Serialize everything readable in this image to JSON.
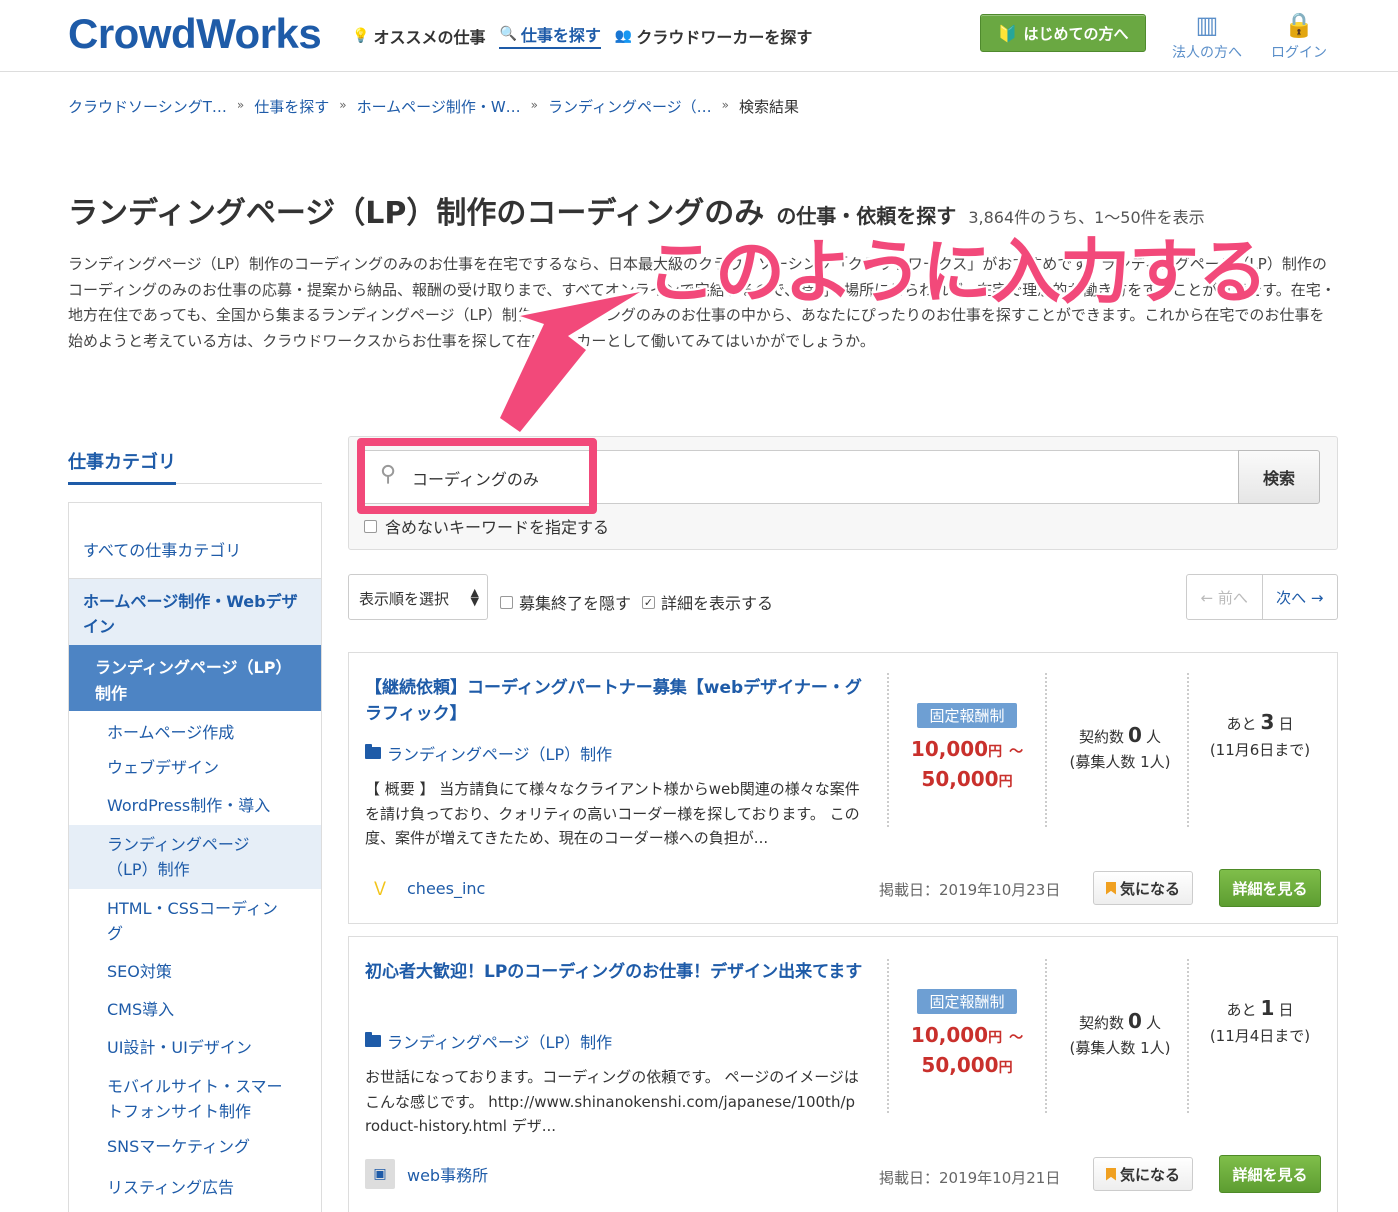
{
  "header": {
    "logo": "CrowdWorks",
    "nav": [
      {
        "label": "オススメの仕事",
        "icon": "lightbulb-icon"
      },
      {
        "label": "仕事を探す",
        "icon": "search-icon"
      },
      {
        "label": "クラウドワーカーを探す",
        "icon": "users-icon"
      }
    ],
    "first_button": "はじめての方へ",
    "corp_link": "法人の方へ",
    "login_link": "ログイン"
  },
  "breadcrumb": [
    "クラウドソーシングT…",
    "仕事を探す",
    "ホームページ制作・W…",
    "ランディングページ（…",
    "検索結果"
  ],
  "title": {
    "main": "ランディングページ（LP）制作のコーディングのみ",
    "sub": "の仕事・依頼を探す",
    "count": "3,864件のうち、1〜50件を表示"
  },
  "description": "ランディングページ（LP）制作のコーディングのみのお仕事を在宅でするなら、日本最大級のクラウドソーシング「クラウドワークス」がおすすめです。ランディングページ（LP）制作のコーディングのみのお仕事の応募・提案から納品、報酬の受け取りまで、すべてオンラインで完結するので、時間や場所にとらわれず、在宅で理想的な働き方をすることが可能です。在宅・地方在住であっても、全国から集まるランディングページ（LP）制作のコーディングのみのお仕事の中から、あなたにぴったりのお仕事を探すことができます。これから在宅でのお仕事を始めようと考えている方は、クラウドワークスからお仕事を探して在宅ワーカーとして働いてみてはいかがでしょうか。",
  "annotation": "このように入力する",
  "sidebar": {
    "heading": "仕事カテゴリ",
    "all": "すべての仕事カテゴリ",
    "parent": "ホームページ制作・Webデザイン",
    "current": "ランディングページ（LP）制作",
    "children": [
      "ホームページ作成",
      "ウェブデザイン",
      "WordPress制作・導入",
      "ランディングページ（LP）制作",
      "HTML・CSSコーディング",
      "SEO対策",
      "CMS導入",
      "UI設計・UIデザイン",
      "モバイルサイト・スマートフォンサイト制作",
      "SNSマーケティング",
      "リスティング広告"
    ]
  },
  "search": {
    "value": "コーディングのみ",
    "button": "検索",
    "exclude_label": "含めないキーワードを指定する"
  },
  "filters": {
    "sort": "表示順を選択",
    "hide_closed": "募集終了を隠す",
    "show_details": "詳細を表示する",
    "prev": "← 前へ",
    "next": "次へ →"
  },
  "jobs": [
    {
      "title": "【継続依頼】コーディングパートナー募集【webデザイナー・グラフィック】",
      "category": "ランディングページ（LP）制作",
      "description": "【 概要 】 当方請負にて様々なクライアント様からweb関連の様々な案件を請け負っており、クォリティの高いコーダー様を探しております。 この度、案件が増えてきたため、現在のコーダー様への負担が...",
      "type": "固定報酬制",
      "price_min": "10,000",
      "price_max": "50,000",
      "yen": "円",
      "tilde": "〜",
      "contract_label": "契約数",
      "contracts": "0",
      "person": "人",
      "recruit": "(募集人数 1人)",
      "days_label": "あと",
      "days": "3",
      "day_unit": "日",
      "deadline": "(11月6日まで)",
      "client": "chees_inc",
      "posted": "掲載日：2019年10月23日",
      "fav": "気になる",
      "detail": "詳細を見る"
    },
    {
      "title": "初心者大歓迎！LPのコーディングのお仕事！デザイン出来てます",
      "category": "ランディングページ（LP）制作",
      "description": "お世話になっております。コーディングの依頼です。 ページのイメージはこんな感じです。 http://www.shinanokenshi.com/japanese/100th/product-history.html デザ...",
      "type": "固定報酬制",
      "price_min": "10,000",
      "price_max": "50,000",
      "yen": "円",
      "tilde": "〜",
      "contract_label": "契約数",
      "contracts": "0",
      "person": "人",
      "recruit": "(募集人数 1人)",
      "days_label": "あと",
      "days": "1",
      "day_unit": "日",
      "deadline": "(11月4日まで)",
      "client": "web事務所",
      "posted": "掲載日：2019年10月21日",
      "fav": "気になる",
      "detail": "詳細を見る"
    }
  ],
  "colors": {
    "brand": "#1e5ba8",
    "annotation": "#f2497a",
    "price": "#c9302c",
    "green_button": "#6aa842"
  }
}
